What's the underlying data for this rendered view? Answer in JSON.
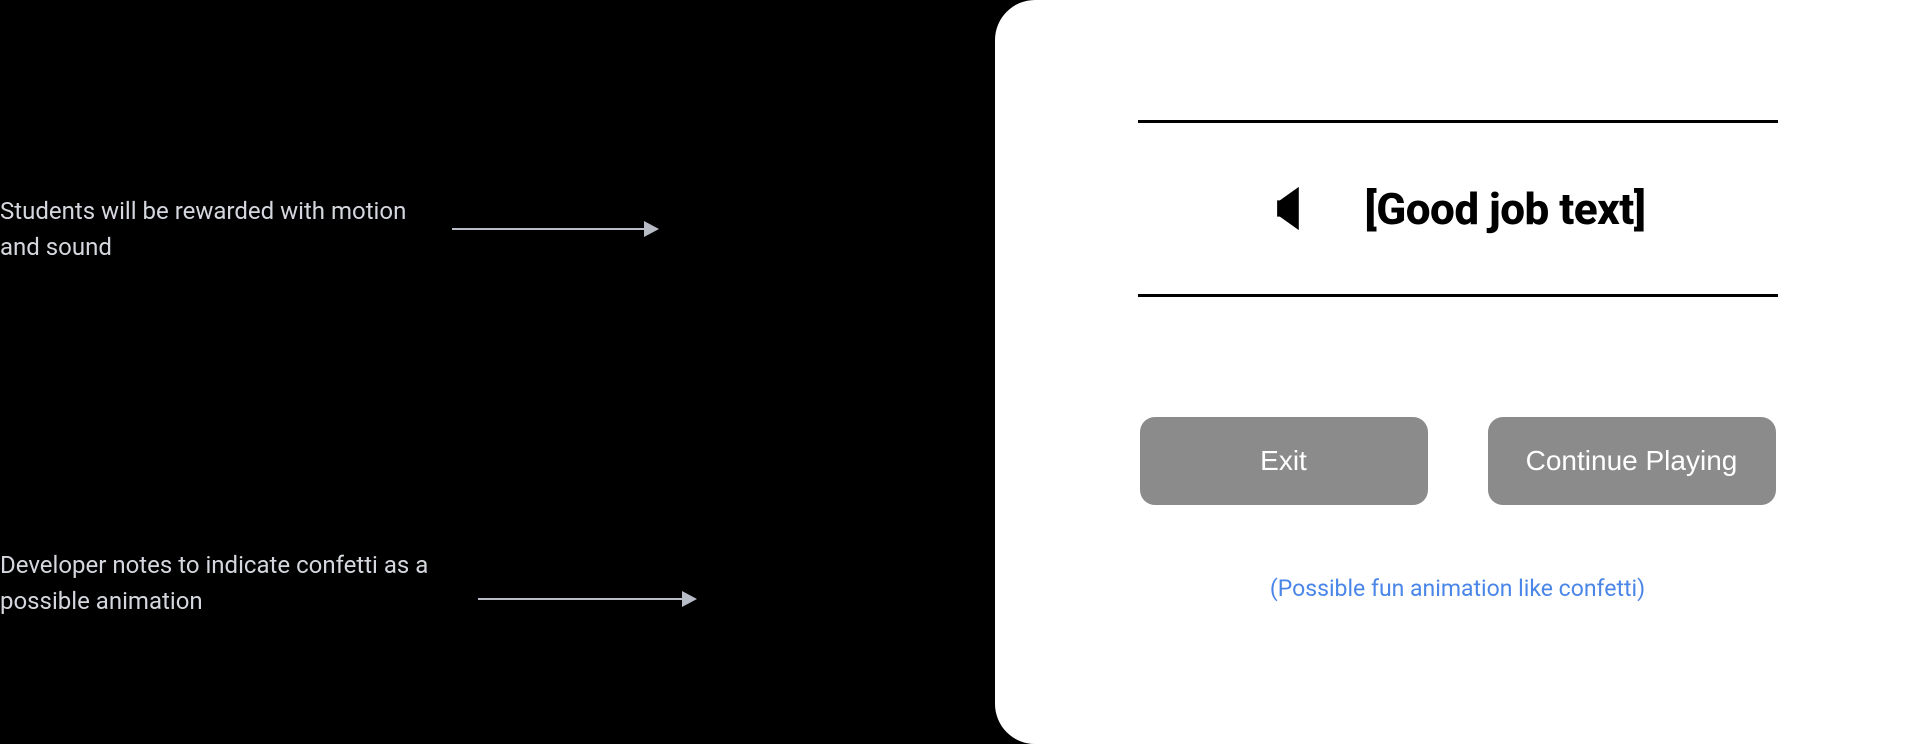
{
  "annotations": {
    "reward": "Students will be rewarded with motion and sound",
    "dev_note_callout": "Developer notes to indicate confetti as a possible animation"
  },
  "panel": {
    "banner_text": "[Good job text]",
    "exit_label": "Exit",
    "continue_label": "Continue Playing",
    "dev_note": "(Possible fun animation like confetti)"
  },
  "icons": {
    "speaker": "speaker-icon"
  }
}
